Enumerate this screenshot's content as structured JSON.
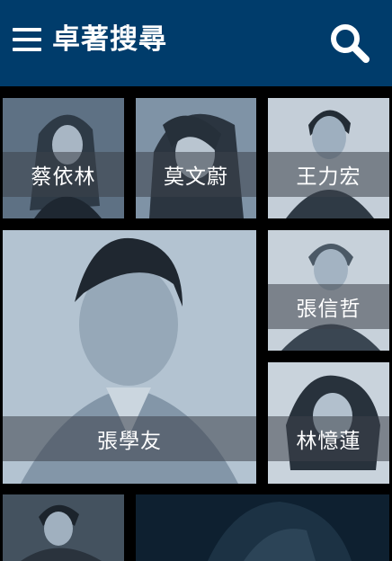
{
  "header": {
    "title": "卓著搜尋",
    "menu_icon": "hamburger-menu-icon",
    "search_icon": "search-icon",
    "background": "#003c6b"
  },
  "grid": {
    "tiles": [
      {
        "name": "蔡依林"
      },
      {
        "name": "莫文蔚"
      },
      {
        "name": "王力宏"
      },
      {
        "name": "張學友"
      },
      {
        "name": "張信哲"
      },
      {
        "name": "林憶蓮"
      },
      {
        "name": ""
      },
      {
        "name": ""
      }
    ]
  }
}
